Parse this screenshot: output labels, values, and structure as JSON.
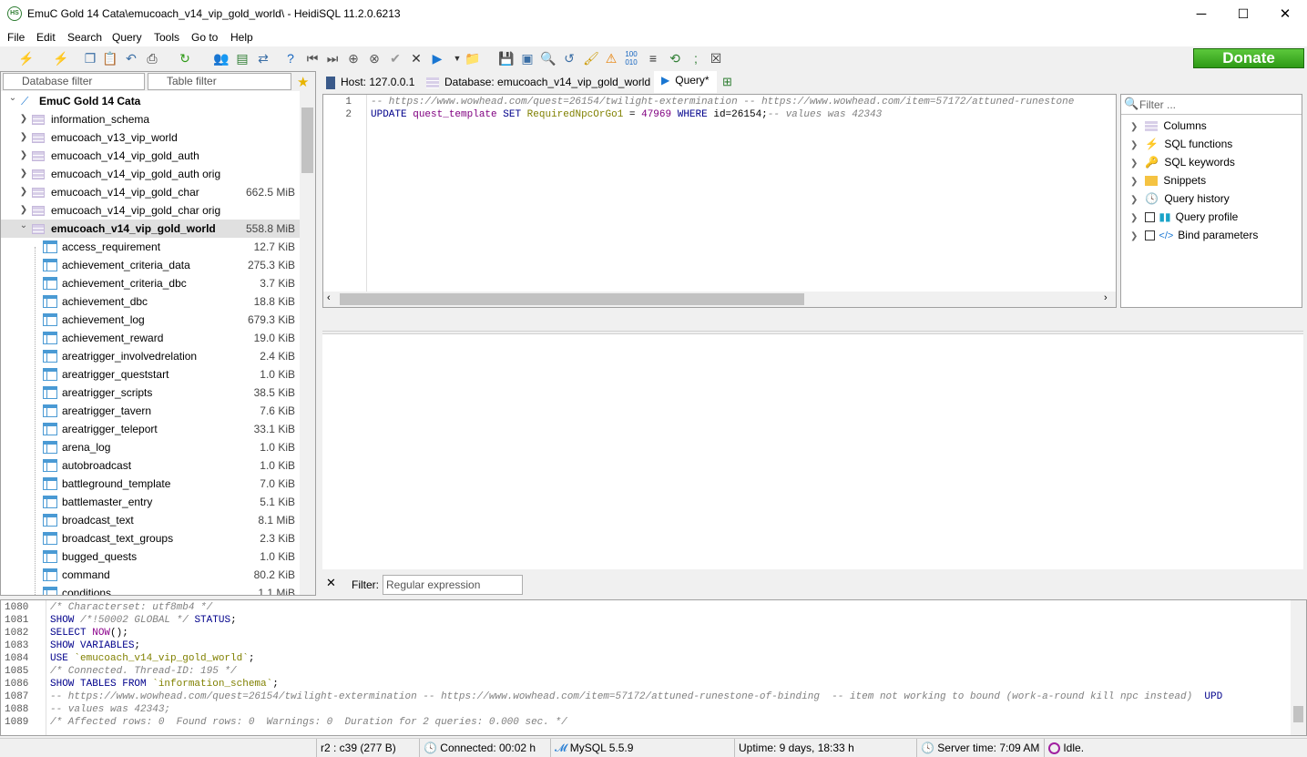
{
  "window": {
    "title": "EmuC Gold 14 Cata\\emucoach_v14_vip_gold_world\\ - HeidiSQL 11.2.0.6213",
    "minimize": "─",
    "maximize": "☐",
    "close": "✕"
  },
  "menu": [
    "File",
    "Edit",
    "Search",
    "Query",
    "Tools",
    "Go to",
    "Help"
  ],
  "donate_label": "Donate",
  "filters": {
    "database": "Database filter",
    "table": "Table filter"
  },
  "tree": {
    "root": "EmuC Gold 14 Cata",
    "databases": [
      {
        "name": "information_schema",
        "size": ""
      },
      {
        "name": "emucoach_v13_vip_world",
        "size": ""
      },
      {
        "name": "emucoach_v14_vip_gold_auth",
        "size": ""
      },
      {
        "name": "emucoach_v14_vip_gold_auth orig",
        "size": ""
      },
      {
        "name": "emucoach_v14_vip_gold_char",
        "size": "662.5 MiB"
      },
      {
        "name": "emucoach_v14_vip_gold_char orig",
        "size": ""
      },
      {
        "name": "emucoach_v14_vip_gold_world",
        "size": "558.8 MiB"
      }
    ],
    "tables": [
      {
        "name": "access_requirement",
        "size": "12.7 KiB"
      },
      {
        "name": "achievement_criteria_data",
        "size": "275.3 KiB"
      },
      {
        "name": "achievement_criteria_dbc",
        "size": "3.7 KiB"
      },
      {
        "name": "achievement_dbc",
        "size": "18.8 KiB"
      },
      {
        "name": "achievement_log",
        "size": "679.3 KiB"
      },
      {
        "name": "achievement_reward",
        "size": "19.0 KiB"
      },
      {
        "name": "areatrigger_involvedrelation",
        "size": "2.4 KiB"
      },
      {
        "name": "areatrigger_queststart",
        "size": "1.0 KiB"
      },
      {
        "name": "areatrigger_scripts",
        "size": "38.5 KiB"
      },
      {
        "name": "areatrigger_tavern",
        "size": "7.6 KiB"
      },
      {
        "name": "areatrigger_teleport",
        "size": "33.1 KiB"
      },
      {
        "name": "arena_log",
        "size": "1.0 KiB"
      },
      {
        "name": "autobroadcast",
        "size": "1.0 KiB"
      },
      {
        "name": "battleground_template",
        "size": "7.0 KiB"
      },
      {
        "name": "battlemaster_entry",
        "size": "5.1 KiB"
      },
      {
        "name": "broadcast_text",
        "size": "8.1 MiB"
      },
      {
        "name": "broadcast_text_groups",
        "size": "2.3 KiB"
      },
      {
        "name": "bugged_quests",
        "size": "1.0 KiB"
      },
      {
        "name": "command",
        "size": "80.2 KiB"
      },
      {
        "name": "conditions",
        "size": "1.1 MiB"
      }
    ]
  },
  "tabs": {
    "host": "Host: 127.0.0.1",
    "database": "Database: emucoach_v14_vip_gold_world",
    "query": "Query*"
  },
  "editor": {
    "line_numbers": [
      "1",
      "2"
    ],
    "line1": "-- https://www.wowhead.com/quest=26154/twilight-extermination -- https://www.wowhead.com/item=57172/attuned-runestone",
    "line2": {
      "kw1": "UPDATE",
      "tbl": "quest_template",
      "kw2": "SET",
      "col": "RequiredNpcOrGo1",
      "eq": " = ",
      "val": "47969",
      "kw3": "WHERE",
      "cond": "id=26154;",
      "comment": "-- values was 42343"
    }
  },
  "helpers": {
    "filter_placeholder": "Filter ...",
    "items": [
      "Columns",
      "SQL functions",
      "SQL keywords",
      "Snippets",
      "Query history",
      "Query profile",
      "Bind parameters"
    ]
  },
  "result_filter": {
    "label": "Filter:",
    "placeholder": "Regular expression"
  },
  "log": [
    {
      "n": "1080",
      "parts": [
        [
          "cm",
          "/* Characterset: utf8mb4 */"
        ]
      ]
    },
    {
      "n": "1081",
      "parts": [
        [
          "kw",
          "SHOW "
        ],
        [
          "cm",
          "/*!50002 GLOBAL */"
        ],
        [
          "kw",
          " STATUS"
        ],
        [
          "",
          ";"
        ]
      ]
    },
    {
      "n": "1082",
      "parts": [
        [
          "kw",
          "SELECT "
        ],
        [
          "fn",
          "NOW"
        ],
        [
          "",
          "();"
        ]
      ]
    },
    {
      "n": "1083",
      "parts": [
        [
          "kw",
          "SHOW VARIABLES"
        ],
        [
          "",
          ";"
        ]
      ]
    },
    {
      "n": "1084",
      "parts": [
        [
          "kw",
          "USE "
        ],
        [
          "st",
          "`emucoach_v14_vip_gold_world`"
        ],
        [
          "",
          ";"
        ]
      ]
    },
    {
      "n": "1085",
      "parts": [
        [
          "cm",
          "/* Connected. Thread-ID: 195 */"
        ]
      ]
    },
    {
      "n": "1086",
      "parts": [
        [
          "kw",
          "SHOW TABLES FROM "
        ],
        [
          "st",
          "`information_schema`"
        ],
        [
          "",
          ";"
        ]
      ]
    },
    {
      "n": "1087",
      "parts": [
        [
          "cm",
          "-- https://www.wowhead.com/quest=26154/twilight-extermination -- https://www.wowhead.com/item=57172/attuned-runestone-of-binding  -- item not working to bound (work-a-round kill npc instead)  "
        ],
        [
          "kw",
          "UPD"
        ]
      ]
    },
    {
      "n": "1088",
      "parts": [
        [
          "cm",
          "-- values was 42343;"
        ]
      ]
    },
    {
      "n": "1089",
      "parts": [
        [
          "cm",
          "/* Affected rows: 0  Found rows: 0  Warnings: 0  Duration for 2 queries: 0.000 sec. */"
        ]
      ]
    }
  ],
  "status": {
    "cursor": "r2 : c39 (277 B)",
    "connected": "Connected: 00:02 h",
    "server": "MySQL 5.5.9",
    "uptime": "Uptime: 9 days, 18:33 h",
    "server_time": "Server time: 7:09 AM",
    "state": "Idle."
  }
}
